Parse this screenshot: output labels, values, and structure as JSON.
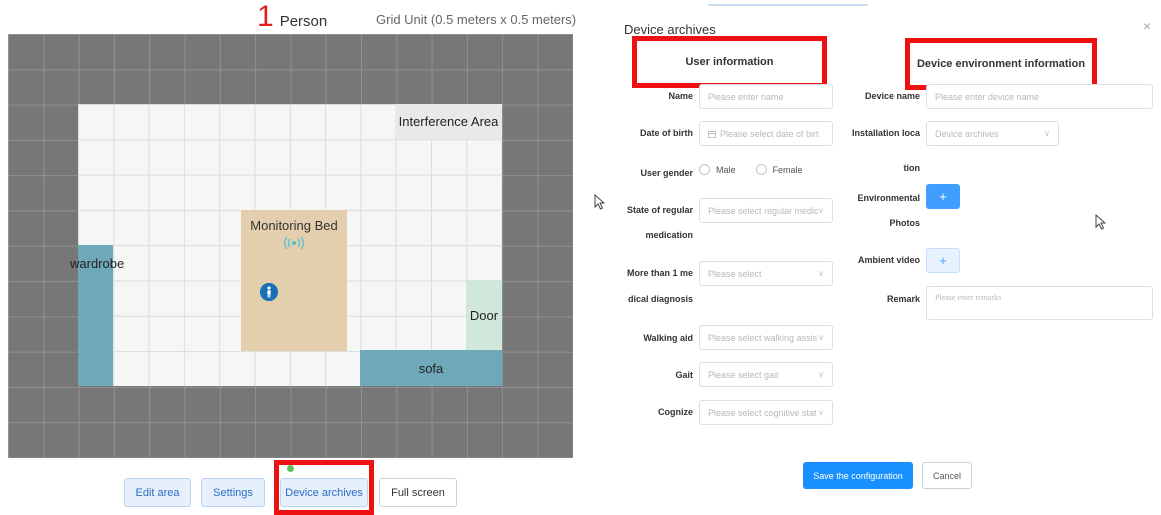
{
  "floor_plan": {
    "person_count": "1",
    "person_label": "Person",
    "grid_unit": "Grid Unit (0.5 meters x 0.5 meters)",
    "zones": {
      "interference": "Interference Area",
      "bed": "Monitoring Bed",
      "wardrobe": "wardrobe",
      "door": "Door",
      "sofa": "sofa"
    },
    "toolbar": {
      "edit_area": "Edit area",
      "settings": "Settings",
      "device_archives": "Device archives",
      "full_screen": "Full screen"
    }
  },
  "dialog": {
    "title": "Device archives",
    "close": "×",
    "user_info": {
      "heading": "User information",
      "name_label": "Name",
      "name_placeholder": "Please enter name",
      "dob_label": "Date of birth",
      "dob_placeholder": "Please select date of birt",
      "gender_label": "User gender",
      "gender_male": "Male",
      "gender_female": "Female",
      "medication_label_1": "State of regular",
      "medication_label_2": "medication",
      "medication_placeholder": "Please select regular medic",
      "diagnosis_label_1": "More than 1 me",
      "diagnosis_label_2": "dical diagnosis",
      "diagnosis_placeholder": "Please select",
      "walking_label": "Walking aid",
      "walking_placeholder": "Please select walking assis",
      "gait_label": "Gait",
      "gait_placeholder": "Please select gait",
      "cognize_label": "Cognize",
      "cognize_placeholder": "Please select cognitive stat"
    },
    "env_info": {
      "heading": "Device environment information",
      "device_name_label": "Device name",
      "device_name_placeholder": "Please enter device name",
      "location_label_1": "Installation loca",
      "location_label_2": "tion",
      "location_placeholder": "Device archives",
      "photos_label_1": "Environmental",
      "photos_label_2": "Photos",
      "photos_add": "+",
      "video_label": "Ambient video",
      "video_add": "+",
      "remark_label": "Remark",
      "remark_placeholder": "Please enter remarks"
    },
    "actions": {
      "save": "Save the configuration",
      "cancel": "Cancel"
    }
  },
  "colors": {
    "highlight": "#ee1111",
    "primary": "#1890ff",
    "zone_blue": "#6fa8b8",
    "bed": "#e3cfae"
  }
}
